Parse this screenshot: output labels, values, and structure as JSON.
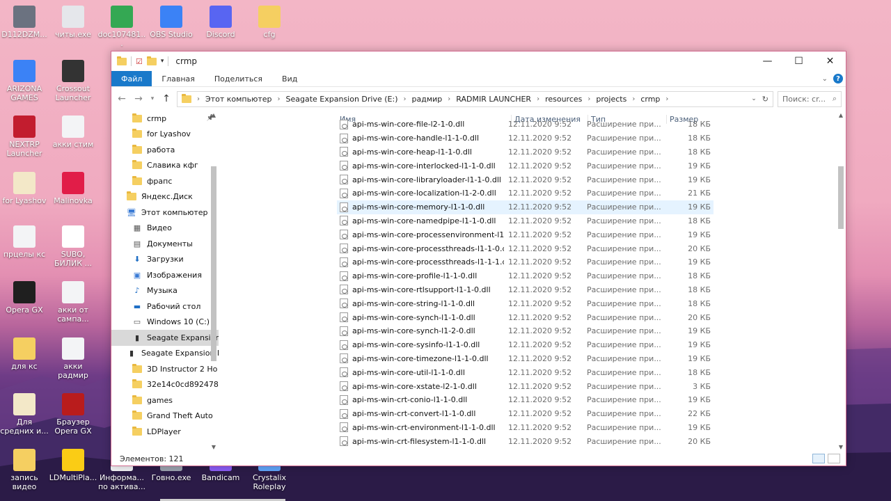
{
  "desktop": {
    "icons": [
      {
        "label": "D112DZM...",
        "icon": "image-icon",
        "color": "#6b7280",
        "col": 0,
        "row": 0
      },
      {
        "label": "читы.exe",
        "icon": "smiley-app-icon",
        "color": "#e5e7eb",
        "col": 1,
        "row": 0
      },
      {
        "label": "doc107481...",
        "icon": "chrome-icon",
        "color": "#34a853",
        "col": 2,
        "row": 0
      },
      {
        "label": "OBS Studio",
        "icon": "shortcut-icon",
        "color": "#3b82f6",
        "col": 3,
        "row": 0
      },
      {
        "label": "Discord",
        "icon": "discord-icon",
        "color": "#5865f2",
        "col": 4,
        "row": 0
      },
      {
        "label": "cfg",
        "icon": "folder-icon",
        "color": "#f5cf61",
        "col": 5,
        "row": 0
      },
      {
        "label": "ARIZONA GAMES",
        "icon": "shortcut-icon",
        "color": "#3b82f6",
        "col": 0,
        "row": 1
      },
      {
        "label": "Crossout Launcher",
        "icon": "crossout-icon",
        "color": "#333333",
        "col": 1,
        "row": 1
      },
      {
        "label": "NEXTRP Launcher",
        "icon": "nextrp-icon",
        "color": "#c21d2f",
        "col": 0,
        "row": 2
      },
      {
        "label": "акки стим",
        "icon": "document-icon",
        "color": "#f3f4f6",
        "col": 1,
        "row": 2
      },
      {
        "label": "for Lyashov",
        "icon": "file-icon",
        "color": "#f3e8c8",
        "col": 0,
        "row": 3
      },
      {
        "label": "Malinovka",
        "icon": "malinovka-icon",
        "color": "#e11d48",
        "col": 1,
        "row": 3
      },
      {
        "label": "прцелы кс",
        "icon": "document-icon",
        "color": "#f3f4f6",
        "col": 0,
        "row": 4
      },
      {
        "label": "SUBO, БИЛИК ...",
        "icon": "image-icon",
        "color": "#ffffff",
        "col": 1,
        "row": 4
      },
      {
        "label": "Opera GX",
        "icon": "opera-gx-icon",
        "color": "#1f1f1f",
        "col": 0,
        "row": 5
      },
      {
        "label": "акки от сампа...",
        "icon": "document-icon",
        "color": "#f3f4f6",
        "col": 1,
        "row": 5
      },
      {
        "label": "для кс",
        "icon": "files-icon",
        "color": "#f5cf61",
        "col": 0,
        "row": 6
      },
      {
        "label": "акки радмир",
        "icon": "document-icon",
        "color": "#f3f4f6",
        "col": 1,
        "row": 6
      },
      {
        "label": "Для средних и...",
        "icon": "file-icon",
        "color": "#f3e8c8",
        "col": 0,
        "row": 7
      },
      {
        "label": "Браузер Opera GX",
        "icon": "opera-gx-icon",
        "color": "#b91c1c",
        "col": 1,
        "row": 7
      },
      {
        "label": "запись видео",
        "icon": "folder-icon",
        "color": "#f5cf61",
        "col": 0,
        "row": 8
      },
      {
        "label": "LDMultiPla...",
        "icon": "ldplayer-icon",
        "color": "#facc15",
        "col": 1,
        "row": 8
      },
      {
        "label": "Информа... по актива...",
        "icon": "document-icon",
        "color": "#f3f4f6",
        "col": 2,
        "row": 8
      },
      {
        "label": "Говно.exe",
        "icon": "app-icon",
        "color": "#9ca3af",
        "col": 3,
        "row": 8
      },
      {
        "label": "Bandicam",
        "icon": "bandicam-icon",
        "color": "#8b5cf6",
        "col": 4,
        "row": 8
      },
      {
        "label": "Crystalix Roleplay",
        "icon": "app-icon",
        "color": "#60a5fa",
        "col": 5,
        "row": 8
      }
    ]
  },
  "window": {
    "title": "crmp",
    "controls": {
      "minimize": "—",
      "maximize": "☐",
      "close": "✕"
    },
    "ribbon_tabs": [
      "Файл",
      "Главная",
      "Поделиться",
      "Вид"
    ],
    "address": {
      "crumbs": [
        "Этот компьютер",
        "Seagate Expansion Drive (E:)",
        "радмир",
        "RADMIR LAUNCHER",
        "resources",
        "projects",
        "crmp"
      ]
    },
    "search": {
      "placeholder": "Поиск: cr..."
    },
    "navpane": [
      {
        "label": "crmp",
        "icon": "folder-icon",
        "level": 2,
        "pinned": true
      },
      {
        "label": "for Lyashov",
        "icon": "folder-icon",
        "level": 2
      },
      {
        "label": "работа",
        "icon": "folder-icon",
        "level": 2
      },
      {
        "label": "Славика кфг",
        "icon": "folder-icon",
        "level": 2
      },
      {
        "label": "фрапс",
        "icon": "folder-icon",
        "level": 2
      },
      {
        "gap": true
      },
      {
        "label": "Яндекс.Диск",
        "icon": "folder-icon",
        "level": 1
      },
      {
        "gap": true
      },
      {
        "label": "Этот компьютер",
        "icon": "computer-icon",
        "level": 1
      },
      {
        "label": "Видео",
        "icon": "video-icon",
        "level": 2
      },
      {
        "label": "Документы",
        "icon": "documents-icon",
        "level": 2
      },
      {
        "label": "Загрузки",
        "icon": "download-icon",
        "level": 2
      },
      {
        "label": "Изображения",
        "icon": "pictures-icon",
        "level": 2
      },
      {
        "label": "Музыка",
        "icon": "music-icon",
        "level": 2
      },
      {
        "label": "Рабочий стол",
        "icon": "desktop-icon",
        "level": 2
      },
      {
        "label": "Windows 10 (C:)",
        "icon": "drive-c-icon",
        "level": 2
      },
      {
        "label": "Seagate Expansion",
        "icon": "external-drive-icon",
        "level": 2,
        "highlight": true
      },
      {
        "gap": true
      },
      {
        "label": "Seagate Expansion D",
        "icon": "external-drive-icon",
        "level": 1
      },
      {
        "label": "3D Instructor 2 Ho",
        "icon": "folder-icon",
        "level": 2
      },
      {
        "label": "32e14c0cd8924785",
        "icon": "folder-icon",
        "level": 2
      },
      {
        "label": "games",
        "icon": "folder-icon",
        "level": 2
      },
      {
        "label": "Grand Theft Auto",
        "icon": "folder-icon",
        "level": 2
      },
      {
        "label": "LDPlayer",
        "icon": "folder-icon",
        "level": 2
      }
    ],
    "columns": {
      "name": "Имя",
      "date": "Дата изменения",
      "type": "Тип",
      "size": "Размер"
    },
    "files": [
      {
        "name": "api-ms-win-core-file-l2-1-0.dll",
        "date": "12.11.2020 9:52",
        "type": "Расширение при...",
        "size": "18 КБ"
      },
      {
        "name": "api-ms-win-core-handle-l1-1-0.dll",
        "date": "12.11.2020 9:52",
        "type": "Расширение при...",
        "size": "18 КБ"
      },
      {
        "name": "api-ms-win-core-heap-l1-1-0.dll",
        "date": "12.11.2020 9:52",
        "type": "Расширение при...",
        "size": "18 КБ"
      },
      {
        "name": "api-ms-win-core-interlocked-l1-1-0.dll",
        "date": "12.11.2020 9:52",
        "type": "Расширение при...",
        "size": "19 КБ"
      },
      {
        "name": "api-ms-win-core-libraryloader-l1-1-0.dll",
        "date": "12.11.2020 9:52",
        "type": "Расширение при...",
        "size": "19 КБ"
      },
      {
        "name": "api-ms-win-core-localization-l1-2-0.dll",
        "date": "12.11.2020 9:52",
        "type": "Расширение при...",
        "size": "21 КБ"
      },
      {
        "name": "api-ms-win-core-memory-l1-1-0.dll",
        "date": "12.11.2020 9:52",
        "type": "Расширение при...",
        "size": "19 КБ",
        "hover": true
      },
      {
        "name": "api-ms-win-core-namedpipe-l1-1-0.dll",
        "date": "12.11.2020 9:52",
        "type": "Расширение при...",
        "size": "18 КБ"
      },
      {
        "name": "api-ms-win-core-processenvironment-l1...",
        "date": "12.11.2020 9:52",
        "type": "Расширение при...",
        "size": "19 КБ"
      },
      {
        "name": "api-ms-win-core-processthreads-l1-1-0.dll",
        "date": "12.11.2020 9:52",
        "type": "Расширение при...",
        "size": "20 КБ"
      },
      {
        "name": "api-ms-win-core-processthreads-l1-1-1.dll",
        "date": "12.11.2020 9:52",
        "type": "Расширение при...",
        "size": "19 КБ"
      },
      {
        "name": "api-ms-win-core-profile-l1-1-0.dll",
        "date": "12.11.2020 9:52",
        "type": "Расширение при...",
        "size": "18 КБ"
      },
      {
        "name": "api-ms-win-core-rtlsupport-l1-1-0.dll",
        "date": "12.11.2020 9:52",
        "type": "Расширение при...",
        "size": "18 КБ"
      },
      {
        "name": "api-ms-win-core-string-l1-1-0.dll",
        "date": "12.11.2020 9:52",
        "type": "Расширение при...",
        "size": "18 КБ"
      },
      {
        "name": "api-ms-win-core-synch-l1-1-0.dll",
        "date": "12.11.2020 9:52",
        "type": "Расширение при...",
        "size": "20 КБ"
      },
      {
        "name": "api-ms-win-core-synch-l1-2-0.dll",
        "date": "12.11.2020 9:52",
        "type": "Расширение при...",
        "size": "19 КБ"
      },
      {
        "name": "api-ms-win-core-sysinfo-l1-1-0.dll",
        "date": "12.11.2020 9:52",
        "type": "Расширение при...",
        "size": "19 КБ"
      },
      {
        "name": "api-ms-win-core-timezone-l1-1-0.dll",
        "date": "12.11.2020 9:52",
        "type": "Расширение при...",
        "size": "19 КБ"
      },
      {
        "name": "api-ms-win-core-util-l1-1-0.dll",
        "date": "12.11.2020 9:52",
        "type": "Расширение при...",
        "size": "18 КБ"
      },
      {
        "name": "api-ms-win-core-xstate-l2-1-0.dll",
        "date": "12.11.2020 9:52",
        "type": "Расширение при...",
        "size": "3 КБ"
      },
      {
        "name": "api-ms-win-crt-conio-l1-1-0.dll",
        "date": "12.11.2020 9:52",
        "type": "Расширение при...",
        "size": "19 КБ"
      },
      {
        "name": "api-ms-win-crt-convert-l1-1-0.dll",
        "date": "12.11.2020 9:52",
        "type": "Расширение при...",
        "size": "22 КБ"
      },
      {
        "name": "api-ms-win-crt-environment-l1-1-0.dll",
        "date": "12.11.2020 9:52",
        "type": "Расширение при...",
        "size": "19 КБ"
      },
      {
        "name": "api-ms-win-crt-filesystem-l1-1-0.dll",
        "date": "12.11.2020 9:52",
        "type": "Расширение при...",
        "size": "20 КБ"
      }
    ],
    "status": {
      "items_count": "Элементов: 121"
    }
  }
}
